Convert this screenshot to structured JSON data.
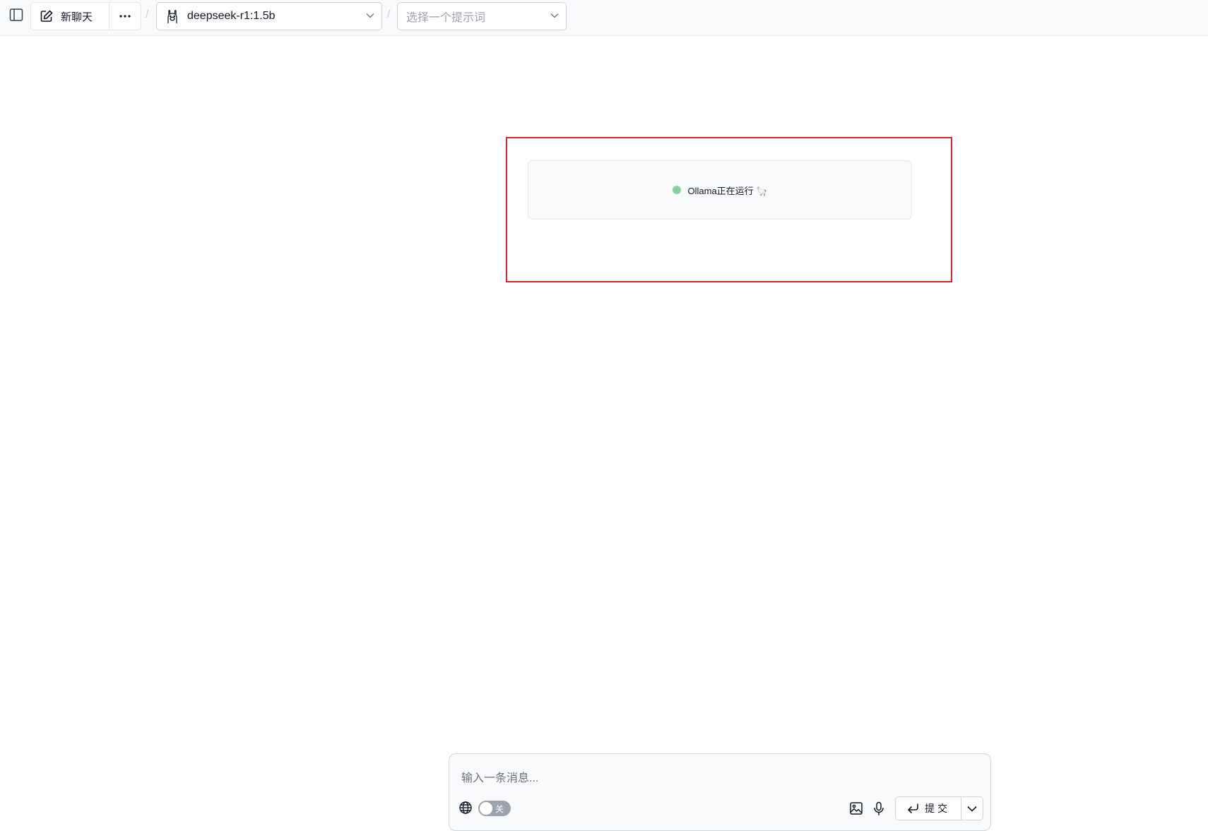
{
  "topbar": {
    "new_chat_label": "新聊天",
    "separator": "/",
    "model": {
      "label": "deepseek-r1:1.5b",
      "icon": "llama-icon"
    },
    "prompt_select": {
      "placeholder": "选择一个提示词"
    }
  },
  "status": {
    "text": "Ollama正在运行 🦙",
    "dot_color": "#86d39a"
  },
  "composer": {
    "placeholder": "输入一条消息...",
    "web_search_toggle": "关",
    "submit_label": "提交"
  },
  "colors": {
    "highlight_border": "#dc2626",
    "topbar_bg": "#f9fafb"
  }
}
